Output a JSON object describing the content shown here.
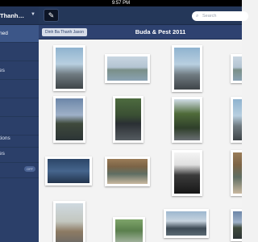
{
  "status_bar": {
    "time": "9:57 PM"
  },
  "sidebar": {
    "title": "Thanh…",
    "items": [
      {
        "label": "ned",
        "selected": true
      },
      {
        "label": ""
      },
      {
        "label": "es"
      },
      {
        "label": ""
      },
      {
        "label": ""
      },
      {
        "label": ""
      },
      {
        "label": "tions"
      },
      {
        "label": "es"
      },
      {
        "label": "",
        "switch": "OFF"
      }
    ]
  },
  "toolbar": {
    "compose_icon": "compose-icon",
    "search_placeholder": "Search"
  },
  "album": {
    "tag": "Dinh Ba Thanh Jason",
    "title": "Buda & Pest 2011"
  },
  "photos": [
    {
      "name": "photo-road",
      "style": "p-sky"
    },
    {
      "name": "photo-river-bank",
      "style": "p-river"
    },
    {
      "name": "photo-castle-street",
      "style": "p-sky"
    },
    {
      "name": "photo-riverside-dusk",
      "style": "p-dusk"
    },
    {
      "name": "photo-person-trees",
      "style": "p-person"
    },
    {
      "name": "photo-person-walking",
      "style": "p-tree"
    },
    {
      "name": "photo-person-waterfront",
      "style": "p-lake"
    },
    {
      "name": "photo-building-balconies",
      "style": "p-bldg"
    },
    {
      "name": "photo-bw-doorway",
      "style": "p-bw"
    },
    {
      "name": "photo-city-view",
      "style": "p-town"
    },
    {
      "name": "photo-person-smiling",
      "style": "p-green"
    },
    {
      "name": "photo-harbor",
      "style": "p-port"
    }
  ]
}
